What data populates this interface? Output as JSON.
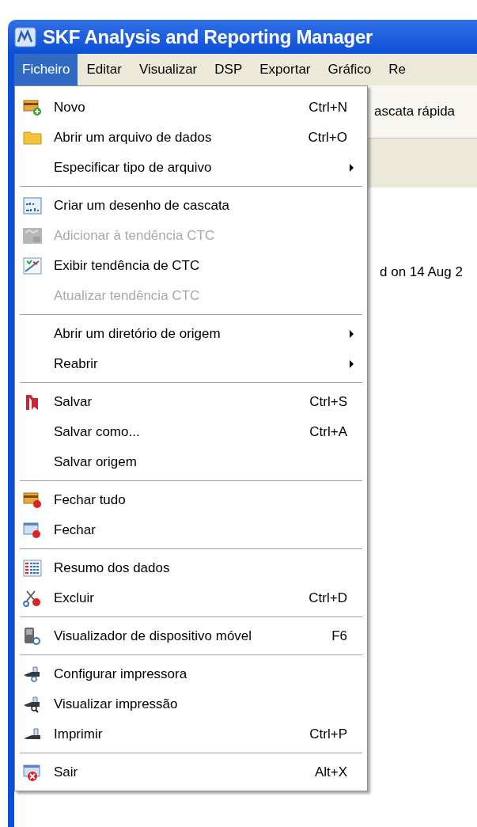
{
  "window": {
    "title": "SKF Analysis and Reporting Manager"
  },
  "menu_bar": [
    {
      "label": "Ficheiro",
      "selected": true
    },
    {
      "label": "Editar",
      "selected": false
    },
    {
      "label": "Visualizar",
      "selected": false
    },
    {
      "label": "DSP",
      "selected": false
    },
    {
      "label": "Exportar",
      "selected": false
    },
    {
      "label": "Gráfico",
      "selected": false
    },
    {
      "label": "Re",
      "selected": false
    }
  ],
  "background": {
    "toolbar_text": "ascata rápida",
    "content_text": "d on 14 Aug 2"
  },
  "menu": [
    {
      "kind": "item",
      "label": "Novo",
      "shortcut": "Ctrl+N",
      "disabled": false,
      "submenu": false
    },
    {
      "kind": "item",
      "label": "Abrir um arquivo de dados",
      "shortcut": "Ctrl+O",
      "disabled": false,
      "submenu": false
    },
    {
      "kind": "item",
      "label": "Especificar tipo de arquivo",
      "disabled": false,
      "submenu": true
    },
    {
      "kind": "separator"
    },
    {
      "kind": "item",
      "label": "Criar um desenho de cascata",
      "disabled": false,
      "submenu": false
    },
    {
      "kind": "item",
      "label": "Adicionar à tendência CTC",
      "disabled": true,
      "submenu": false
    },
    {
      "kind": "item",
      "label": "Exibir tendência de CTC",
      "disabled": false,
      "submenu": false
    },
    {
      "kind": "item",
      "label": "Atualizar tendência CTC",
      "disabled": true,
      "submenu": false
    },
    {
      "kind": "separator"
    },
    {
      "kind": "item",
      "label": "Abrir um diretório de origem",
      "disabled": false,
      "submenu": true
    },
    {
      "kind": "item",
      "label": "Reabrir",
      "disabled": false,
      "submenu": true
    },
    {
      "kind": "separator"
    },
    {
      "kind": "item",
      "label": "Salvar",
      "shortcut": "Ctrl+S",
      "disabled": false,
      "submenu": false
    },
    {
      "kind": "item",
      "label": "Salvar como...",
      "shortcut": "Ctrl+A",
      "disabled": false,
      "submenu": false
    },
    {
      "kind": "item",
      "label": "Salvar origem",
      "disabled": false,
      "submenu": false
    },
    {
      "kind": "separator"
    },
    {
      "kind": "item",
      "label": "Fechar tudo",
      "disabled": false,
      "submenu": false
    },
    {
      "kind": "item",
      "label": "Fechar",
      "disabled": false,
      "submenu": false
    },
    {
      "kind": "separator"
    },
    {
      "kind": "item",
      "label": "Resumo dos dados",
      "disabled": false,
      "submenu": false
    },
    {
      "kind": "item",
      "label": "Excluir",
      "shortcut": "Ctrl+D",
      "disabled": false,
      "submenu": false
    },
    {
      "kind": "separator"
    },
    {
      "kind": "item",
      "label": "Visualizador de dispositivo móvel",
      "shortcut": "F6",
      "disabled": false,
      "submenu": false
    },
    {
      "kind": "separator"
    },
    {
      "kind": "item",
      "label": "Configurar impressora",
      "disabled": false,
      "submenu": false
    },
    {
      "kind": "item",
      "label": "Visualizar impressão",
      "disabled": false,
      "submenu": false
    },
    {
      "kind": "item",
      "label": "Imprimir",
      "shortcut": "Ctrl+P",
      "disabled": false,
      "submenu": false
    },
    {
      "kind": "separator"
    },
    {
      "kind": "item",
      "label": "Sair",
      "shortcut": "Alt+X",
      "disabled": false,
      "submenu": false
    }
  ]
}
